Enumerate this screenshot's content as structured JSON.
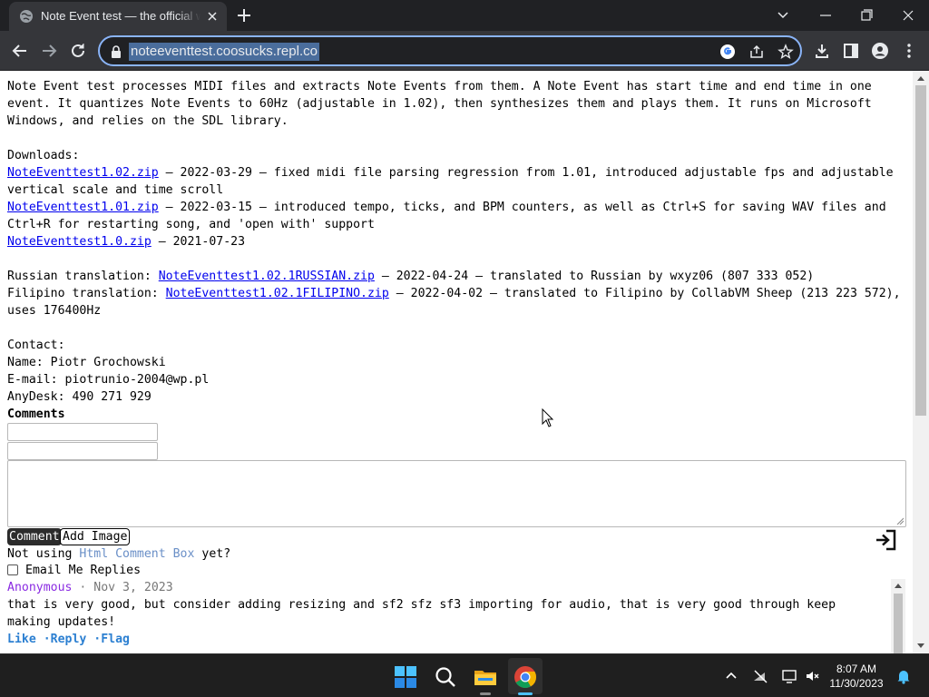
{
  "browser": {
    "tab_title": "Note Event test — the official website",
    "url": "noteeventtest.coosucks.repl.co"
  },
  "page": {
    "intro": "Note Event test processes MIDI files and extracts Note Events from them. A Note Event has start time and end time in one event. It quantizes Note Events to 60Hz (adjustable in 1.02), then synthesizes them and plays them. It runs on Microsoft Windows, and relies on the SDL library.",
    "downloads_heading": "Downloads:",
    "downloads": [
      {
        "link": "NoteEventtest1.02.zip",
        "desc": " — 2022-03-29 — fixed midi file parsing regression from 1.01, introduced adjustable fps and adjustable vertical scale and time scroll"
      },
      {
        "link": "NoteEventtest1.01.zip",
        "desc": " — 2022-03-15 — introduced tempo, ticks, and BPM counters, as well as Ctrl+S for saving WAV files and Ctrl+R for restarting song, and 'open with' support"
      },
      {
        "link": "NoteEventtest1.0.zip",
        "desc": " — 2021-07-23"
      }
    ],
    "translations": [
      {
        "label": "Russian translation: ",
        "link": "NoteEventtest1.02.1RUSSIAN.zip",
        "desc": " — 2022-04-24 — translated to Russian by wxyz06 (807 333 052)"
      },
      {
        "label": "Filipino translation: ",
        "link": "NoteEventtest1.02.1FILIPINO.zip",
        "desc": " — 2022-04-02 — translated to Filipino by CollabVM Sheep (213 223 572), uses 176400Hz"
      }
    ],
    "contact_heading": "Contact:",
    "contact_name": "Name: Piotr Grochowski",
    "contact_email": "E-mail: piotrunio-2004@wp.pl",
    "contact_anydesk": "AnyDesk: 490 271 929"
  },
  "comments": {
    "heading": "Comments",
    "comment_button": "Comment",
    "add_image_button": "Add Image",
    "not_using_prefix": "Not using ",
    "not_using_link": "Html Comment Box",
    "not_using_suffix": "  yet?",
    "email_replies": "Email Me Replies",
    "items": [
      {
        "author": "Anonymous",
        "date": "· Nov 3, 2023",
        "text": "that is very good, but consider adding resizing and sf2 sfz sf3 importing for audio, that is very good through keep making updates!",
        "actions": "Like ·Reply ·Flag"
      }
    ]
  },
  "taskbar": {
    "time": "8:07 AM",
    "date": "11/30/2023",
    "apps": [
      "start-icon",
      "search-icon",
      "file-explorer-icon",
      "chrome-icon"
    ]
  },
  "colors": {
    "link": "#0000ee",
    "hcb_link": "#6a8fc7",
    "author": "#8a2be2",
    "actions": "#2b7fd1",
    "omnibox_focus": "#8ab4f8"
  }
}
